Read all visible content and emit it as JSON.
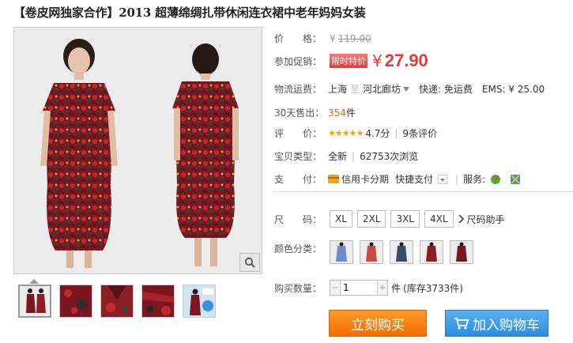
{
  "title": "【卷皮网独家合作】2013 超薄绵绸扎带休闲连衣裙中老年妈妈女装",
  "price": {
    "label": "价　　格：",
    "currency": "¥",
    "original": "119.00"
  },
  "promo": {
    "label": "参加促销：",
    "tag": "限时特价",
    "currency": "¥",
    "price": "27.90"
  },
  "shipping": {
    "label": "物流运费：",
    "from": "上海",
    "sep": "至",
    "to": "河北廊坊",
    "express": "快递: 免运费",
    "ems": "EMS: ¥ 25.00"
  },
  "sales": {
    "label": "30天售出：",
    "count": "354",
    "unit": "件"
  },
  "rating": {
    "label": "评　　价：",
    "stars": "★★★★★",
    "score": "4.7分",
    "reviews": "9条评价"
  },
  "type": {
    "label": "宝贝类型：",
    "value": "全新",
    "views": "62753次浏览"
  },
  "payment": {
    "label": "支　　付：",
    "credit": "信用卡分期",
    "quick": "快捷支付",
    "service_label": "服务:"
  },
  "size": {
    "label": "尺　　码：",
    "options": [
      "XL",
      "2XL",
      "3XL",
      "4XL"
    ],
    "helper": "尺码助手"
  },
  "color": {
    "label": "颜色分类："
  },
  "quantity": {
    "label": "购买数量：",
    "value": "1",
    "unit": "件",
    "stock": "(库存3733件)"
  },
  "actions": {
    "buy": "立刻购买",
    "cart": "加入购物车"
  },
  "colors": {
    "accent": "#e4393c",
    "buy": "#f57d00",
    "cart": "#3b99e0",
    "dress": "#8a1a22"
  }
}
